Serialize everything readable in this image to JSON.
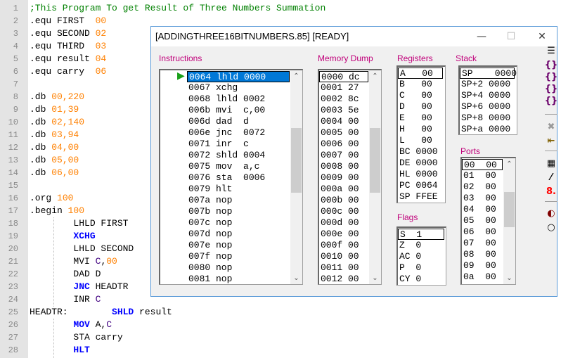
{
  "editor": {
    "lines": [
      [
        [
          "c-com",
          ";This Program To get Result of Three Numbers Summation"
        ]
      ],
      [
        [
          "",
          ".equ FIRST  "
        ],
        [
          "c-num",
          "00"
        ]
      ],
      [
        [
          "",
          ".equ SECOND "
        ],
        [
          "c-num",
          "02"
        ]
      ],
      [
        [
          "",
          ".equ THIRD  "
        ],
        [
          "c-num",
          "03"
        ]
      ],
      [
        [
          "",
          ".equ result "
        ],
        [
          "c-num",
          "04"
        ]
      ],
      [
        [
          "",
          ".equ carry  "
        ],
        [
          "c-num",
          "06"
        ]
      ],
      [],
      [
        [
          "",
          ".db "
        ],
        [
          "c-num",
          "00,220"
        ]
      ],
      [
        [
          "",
          ".db "
        ],
        [
          "c-num",
          "01,39"
        ]
      ],
      [
        [
          "",
          ".db "
        ],
        [
          "c-num",
          "02,140"
        ]
      ],
      [
        [
          "",
          ".db "
        ],
        [
          "c-num",
          "03,94"
        ]
      ],
      [
        [
          "",
          ".db "
        ],
        [
          "c-num",
          "04,00"
        ]
      ],
      [
        [
          "",
          ".db "
        ],
        [
          "c-num",
          "05,00"
        ]
      ],
      [
        [
          "",
          ".db "
        ],
        [
          "c-num",
          "06,00"
        ]
      ],
      [],
      [
        [
          "",
          ".org "
        ],
        [
          "c-num",
          "100"
        ]
      ],
      [
        [
          "",
          ".begin "
        ],
        [
          "c-num",
          "100"
        ]
      ],
      [
        [
          "",
          "        LHLD FIRST"
        ]
      ],
      [
        [
          "c-kw",
          "        XCHG"
        ]
      ],
      [
        [
          "",
          "        LHLD SECOND"
        ]
      ],
      [
        [
          "",
          "        MVI "
        ],
        [
          "c-reg",
          "C"
        ],
        [
          "",
          ","
        ],
        [
          "c-num",
          "00"
        ]
      ],
      [
        [
          "",
          "        DAD D"
        ]
      ],
      [
        [
          "c-kw",
          "        JNC"
        ],
        [
          "",
          " HEADTR"
        ]
      ],
      [
        [
          "",
          "        INR "
        ],
        [
          "c-reg",
          "C"
        ]
      ],
      [
        [
          "",
          "HEADTR:        "
        ],
        [
          "c-kw",
          "SHLD"
        ],
        [
          "",
          " result"
        ]
      ],
      [
        [
          "c-kw",
          "        MOV"
        ],
        [
          "",
          " A,"
        ],
        [
          "c-reg",
          "C"
        ]
      ],
      [
        [
          "",
          "        STA carry"
        ]
      ],
      [
        [
          "c-kw",
          "        HLT"
        ]
      ]
    ]
  },
  "window": {
    "title": "[ADDINGTHREE16BITNUMBERS.85]  [READY]",
    "minimize": "—",
    "maximize": "☐",
    "close": "✕"
  },
  "instructions": {
    "label": "Instructions",
    "rows": [
      "0064 lhld 0000",
      "0067 xchg",
      "0068 lhld 0002",
      "006b mvi  c,00",
      "006d dad  d",
      "006e jnc  0072",
      "0071 inr  c",
      "0072 shld 0004",
      "0075 mov  a,c",
      "0076 sta  0006",
      "0079 hlt",
      "007a nop",
      "007b nop",
      "007c nop",
      "007d nop",
      "007e nop",
      "007f nop",
      "0080 nop",
      "0081 nop"
    ]
  },
  "memory": {
    "label": "Memory Dump",
    "rows": [
      "0000 dc",
      "0001 27",
      "0002 8c",
      "0003 5e",
      "0004 00",
      "0005 00",
      "0006 00",
      "0007 00",
      "0008 00",
      "0009 00",
      "000a 00",
      "000b 00",
      "000c 00",
      "000d 00",
      "000e 00",
      "000f 00",
      "0010 00",
      "0011 00",
      "0012 00"
    ]
  },
  "registers": {
    "label": "Registers",
    "rows": [
      "A   00",
      "B   00",
      "C   00",
      "D   00",
      "E   00",
      "H   00",
      "L   00",
      "BC 0000",
      "DE 0000",
      "HL 0000",
      "PC 0064",
      "SP FFEE"
    ]
  },
  "flags": {
    "label": "Flags",
    "rows": [
      "S  1",
      "Z  0",
      "AC 0",
      "P  0",
      "CY 0"
    ]
  },
  "stack": {
    "label": "Stack",
    "rows": [
      "SP    0000",
      "SP+2 0000",
      "SP+4 0000",
      "SP+6 0000",
      "SP+8 0000",
      "SP+a 0000"
    ]
  },
  "ports": {
    "label": "Ports",
    "rows": [
      "00  00",
      "01  00",
      "02  00",
      "03  00",
      "04  00",
      "05  00",
      "06  00",
      "07  00",
      "08  00",
      "09  00",
      "0a  00"
    ]
  },
  "scroll": {
    "up": "⌃",
    "down": "⌄"
  },
  "toolbar": [
    {
      "name": "load-icon",
      "glyph": "☰"
    },
    {
      "name": "step-into-icon",
      "glyph": "{}"
    },
    {
      "name": "step-over-icon",
      "glyph": "{}"
    },
    {
      "name": "step-out-icon",
      "glyph": "{}"
    },
    {
      "name": "run-to-cursor-icon",
      "glyph": "{}"
    },
    {
      "name": "stop-icon",
      "glyph": "✖"
    },
    {
      "name": "exit-icon",
      "glyph": "⇤"
    },
    {
      "name": "memory-viewer-icon",
      "glyph": "▦"
    },
    {
      "name": "magic-wand-icon",
      "glyph": "⁄"
    },
    {
      "name": "seven-segment-icon",
      "glyph": "8."
    },
    {
      "name": "breakpoint-icon",
      "glyph": "◐"
    },
    {
      "name": "circle-icon",
      "glyph": "○"
    }
  ]
}
